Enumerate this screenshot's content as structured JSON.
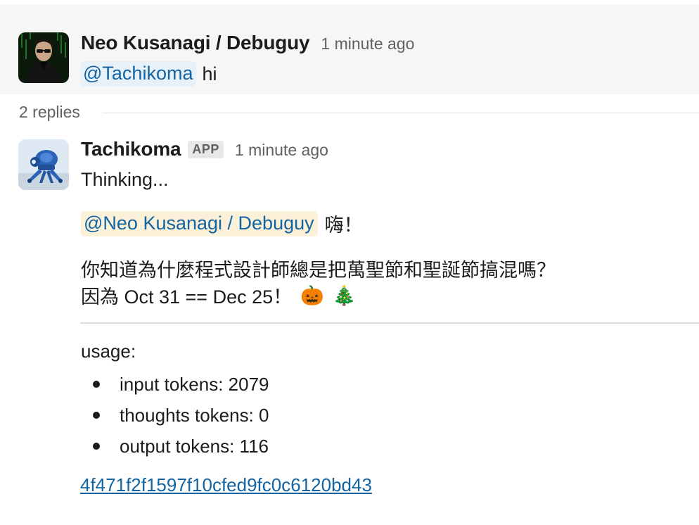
{
  "thread": {
    "parent": {
      "author": "Neo Kusanagi / Debuguy",
      "time": "1 minute ago",
      "mention": "@Tachikoma",
      "text": "hi",
      "avatar_icon": "neo-avatar-icon"
    },
    "replies_label": "2 replies",
    "reply": {
      "author": "Tachikoma",
      "badge": "APP",
      "time": "1 minute ago",
      "thinking": "Thinking...",
      "mention": "@Neo Kusanagi / Debuguy",
      "greeting_after": "嗨！",
      "joke_line1": "你知道為什麼程式設計師總是把萬聖節和聖誕節搞混嗎？",
      "joke_line2": "因為 Oct 31 == Dec 25！",
      "emoji1": "🎃",
      "emoji2": "🎄",
      "usage_label": "usage:",
      "usage_items": [
        "input tokens: 2079",
        "thoughts tokens: 0",
        "output tokens: 116"
      ],
      "hash_link": "4f471f2f1597f10cfed9fc0c6120bd43",
      "avatar_icon": "tachikoma-avatar-icon"
    }
  },
  "colors": {
    "link": "#1264a3",
    "mention_bg_blue": "#e8f0f8",
    "mention_bg_yellow": "#fbf0d8",
    "parent_bg": "#f6f6f6",
    "muted": "#616061"
  }
}
